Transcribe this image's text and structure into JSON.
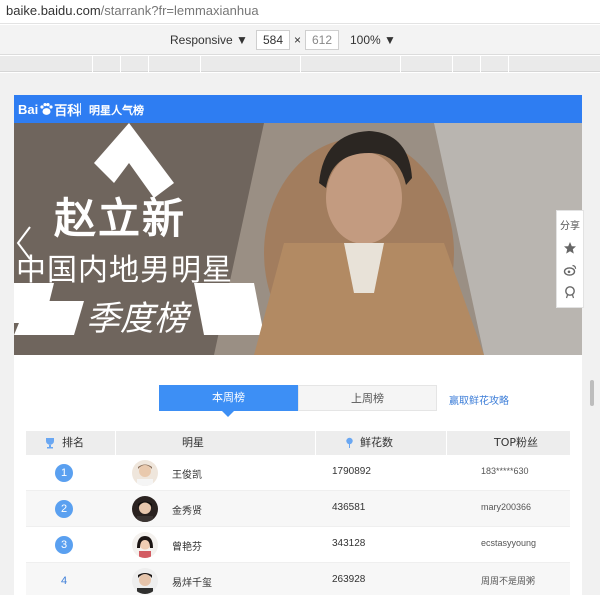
{
  "browser": {
    "url_host": "baike.baidu.com",
    "url_path": "/starrank?fr=lemmaxianhua"
  },
  "devtools": {
    "device": "Responsive",
    "width": "584",
    "times": "×",
    "height": "612",
    "zoom": "100%"
  },
  "header": {
    "logo_left": "Bai",
    "logo_right": "百科",
    "section": "明星人气榜"
  },
  "banner": {
    "line1": "赵立新",
    "line2": "中国内地男明星",
    "line3": "季度榜"
  },
  "side_tools": {
    "share_label": "分享",
    "icons": [
      "star-icon",
      "weibo-icon",
      "qq-icon"
    ]
  },
  "tabs": [
    {
      "label": "本周榜",
      "active": true
    },
    {
      "label": "上周榜",
      "active": false
    }
  ],
  "tips_link": "赢取鲜花攻略",
  "table": {
    "headers": [
      "排名",
      "明星",
      "鲜花数",
      "TOP粉丝"
    ],
    "rows": [
      {
        "rank": "1",
        "name": "王俊凯",
        "flowers": "1790892",
        "fan": "183*****630"
      },
      {
        "rank": "2",
        "name": "金秀贤",
        "flowers": "436581",
        "fan": "mary200366"
      },
      {
        "rank": "3",
        "name": "曾艳芬",
        "flowers": "343128",
        "fan": "ecstasyyoung"
      },
      {
        "rank": "4",
        "name": "易烊千玺",
        "flowers": "263928",
        "fan": "周周不是周粥"
      }
    ]
  },
  "colors": {
    "brand_blue": "#2e7df2",
    "tab_active": "#3d8ff5",
    "rank_badge": "#5aa0f0",
    "link": "#3d7ed8"
  }
}
